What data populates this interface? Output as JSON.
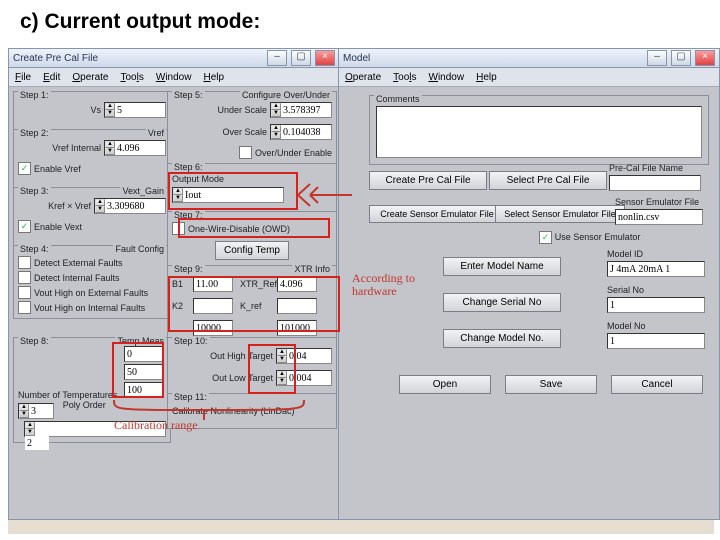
{
  "heading": "c) Current output mode:",
  "left_window": {
    "title": "Create Pre Cal File",
    "menu": [
      "File",
      "Edit",
      "Operate",
      "Tools",
      "Window",
      "Help"
    ]
  },
  "right_window": {
    "title": "Model",
    "menu": [
      "Operate",
      "Tools",
      "Window",
      "Help"
    ]
  },
  "step1": {
    "label": "Step 1:",
    "param": "Vs",
    "value": "5"
  },
  "step2": {
    "label": "Step 2:",
    "title": "Vref",
    "param": "Vref Internal",
    "value": "4.096",
    "chk_label": "Enable Vref",
    "chk": true
  },
  "step3": {
    "label": "Step 3:",
    "title": "Vext_Gain",
    "param": "Kref × Vref",
    "value": "3.309680",
    "chk_label": "Enable Vext",
    "chk": true
  },
  "step4": {
    "label": "Step 4:",
    "title": "Fault Config",
    "opts": [
      "Detect External Faults",
      "Detect Internal Faults",
      "Vout High on External Faults",
      "Vout High on Internal Faults"
    ]
  },
  "step5": {
    "label": "Step 5:",
    "title": "Configure Over/Under",
    "under_label": "Under Scale",
    "under_val": "3.578397",
    "over_label": "Over Scale",
    "over_val": "0.104038",
    "enable_label": "Over/Under Enable",
    "enable": false
  },
  "step6": {
    "label": "Step 6:",
    "mode_label": "Output Mode",
    "mode_value": "Iout"
  },
  "step7": {
    "label": "Step 7:",
    "owd_label": "One-Wire-Disable (OWD)",
    "owd": false,
    "btn": "Config Temp"
  },
  "step8": {
    "label": "Step 8:",
    "temp_title": "Temp Meas",
    "t1": "0",
    "t2": "50",
    "t3": "100",
    "num_label": "Number of Temperatures",
    "num": "3",
    "poly_label": "Poly Order",
    "poly": "2"
  },
  "step9": {
    "label": "Step 9:",
    "title": "XTR Info",
    "b1_lbl": "B1",
    "b1": "11.00",
    "xref_lbl": "XTR_Ref",
    "xref": "4.096",
    "k2_lbl": "K2",
    "k2": "",
    "k_ref_lbl": "K_ref",
    "k_ref": "",
    "row3a": "10000",
    "row3b": "101000"
  },
  "step10": {
    "label": "Step 10:",
    "hi_lbl": "Out High Target",
    "hi": "0.04",
    "lo_lbl": "Out Low Target",
    "lo": "0.004"
  },
  "step11": {
    "label": "Step 11:",
    "txt": "Calibrate Nonlinearity (LinDac)"
  },
  "right_panel": {
    "comments_label": "Comments",
    "create_btn": "Create Pre Cal File",
    "select_btn": "Select Pre Cal File",
    "create_sef": "Create Sensor Emulator File",
    "select_sef": "Select Sensor Emulator File",
    "use_sef_label": "Use Sensor Emulator",
    "use_sef": true,
    "precal_name_label": "Pre-Cal File Name",
    "precal_name": "",
    "sef_name_label": "Sensor Emulator File",
    "sef_name": "nonlin.csv",
    "model_name_label": "Enter Model Name",
    "model_id_label": "Model ID",
    "model_id": "J 4mA 20mA 1",
    "serial_btn": "Change Serial No",
    "serial_label": "Serial No",
    "serial": "1",
    "modelno_btn": "Change Model No.",
    "modelno_label": "Model No",
    "modelno": "1",
    "open": "Open",
    "save": "Save",
    "cancel": "Cancel"
  },
  "annotations": {
    "hw": "According to hardware",
    "cal": "Calibration range"
  }
}
